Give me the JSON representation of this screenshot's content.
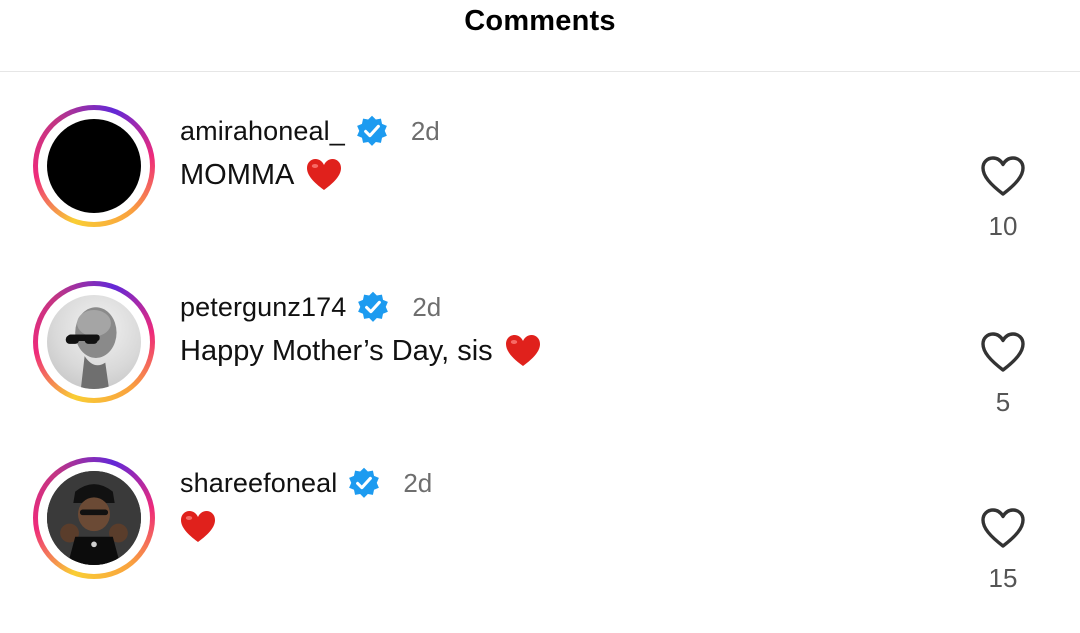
{
  "header": {
    "title": "Comments"
  },
  "colors": {
    "verified": "#1d9bf0",
    "heart": "#e0211c",
    "muted": "#6e6e6e"
  },
  "comments": [
    {
      "username": "amirahoneal_",
      "verified": true,
      "time": "2d",
      "text": "MOMMA",
      "emoji": "red-heart",
      "likes": "10",
      "avatar": "black-avatar"
    },
    {
      "username": "petergunz174",
      "verified": true,
      "time": "2d",
      "text": "Happy Mother’s Day, sis",
      "emoji": "red-heart",
      "likes": "5",
      "avatar": "bald-man-sunglasses-avatar"
    },
    {
      "username": "shareefoneal",
      "verified": true,
      "time": "2d",
      "text": "",
      "emoji": "red-heart",
      "likes": "15",
      "avatar": "man-hat-avatar"
    }
  ]
}
